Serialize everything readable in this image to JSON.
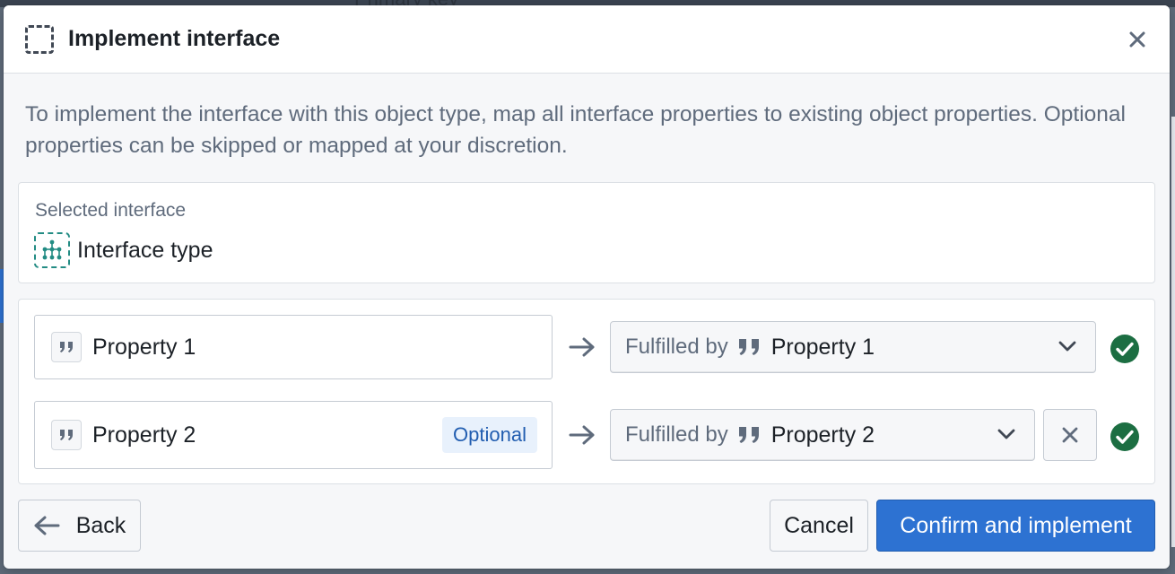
{
  "backdrop": {
    "hint_text": "Primary key"
  },
  "dialog": {
    "title": "Implement interface",
    "header_icon": "dashed-square-icon",
    "close_icon": "close-icon",
    "description": "To implement the interface with this object type, map all interface properties to existing object properties. Optional properties can be skipped or mapped at your discretion."
  },
  "selected_interface": {
    "label": "Selected interface",
    "icon": "interface-icon",
    "name": "Interface type"
  },
  "mappings": [
    {
      "property": "Property 1",
      "optional_label": "",
      "fulfilled_prefix": "Fulfilled by",
      "fulfilled_value": "Property 1",
      "status": "valid"
    },
    {
      "property": "Property 2",
      "optional_label": "Optional",
      "fulfilled_prefix": "Fulfilled by",
      "fulfilled_value": "Property 2",
      "status": "valid"
    }
  ],
  "footer": {
    "back_label": "Back",
    "cancel_label": "Cancel",
    "confirm_label": "Confirm and implement"
  },
  "colors": {
    "primary": "#2d72d2",
    "success": "#1c6e42",
    "interface_teal": "#238c84",
    "text": "#1c2127",
    "muted_text": "#5f6b7c",
    "optional_tag_bg": "#e8f1fc",
    "optional_tag_text": "#215db0"
  }
}
